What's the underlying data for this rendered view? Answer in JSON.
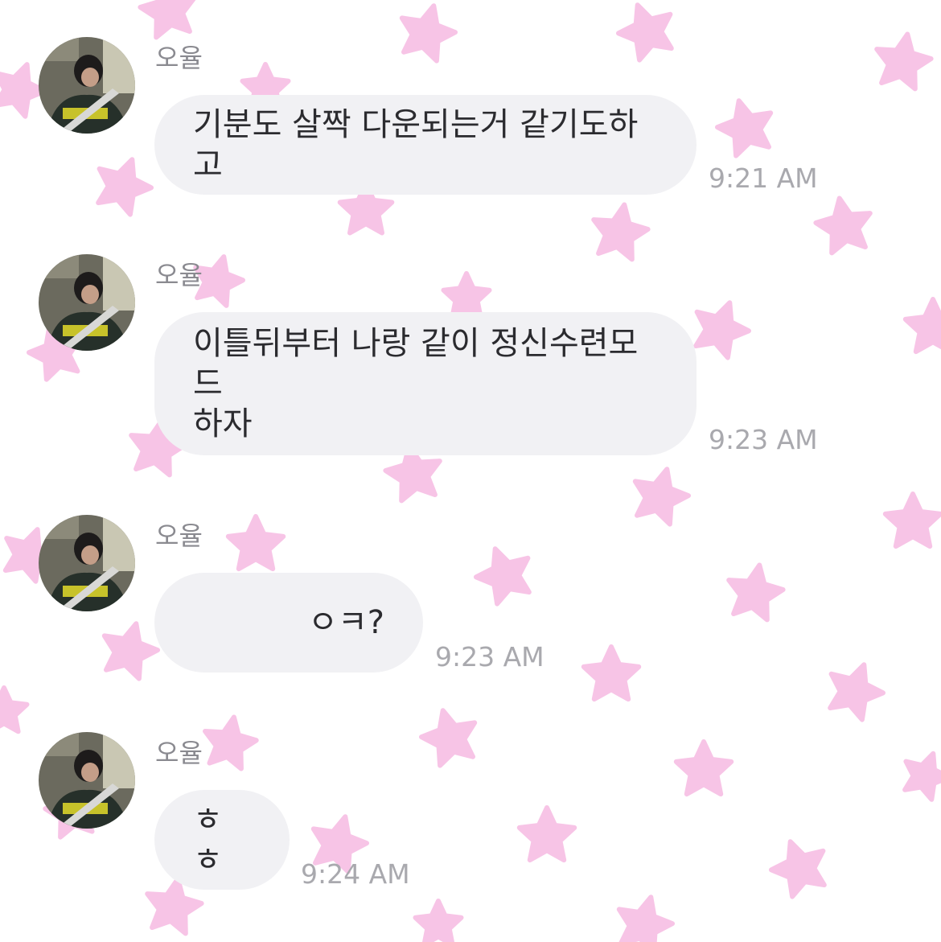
{
  "chat": {
    "messages": [
      {
        "sender": "오율",
        "text": "기분도 살짝 다운되는거 같기도하고",
        "time": "9:21 AM"
      },
      {
        "sender": "오율",
        "text": "이틀뒤부터 나랑 같이 정신수련모드\n하자",
        "time": "9:23 AM"
      },
      {
        "sender": "오율",
        "text": "ㅇㅋ?",
        "time": "9:23 AM"
      },
      {
        "sender": "오율",
        "text": "ㅎㅎ",
        "time": "9:24 AM"
      }
    ]
  },
  "theme": {
    "background": "#ffffff",
    "star_color": "#f7c4e6",
    "bubble_color": "#f1f1f4",
    "sender_color": "#8a8a90",
    "time_color": "#a9a9ae",
    "text_color": "#2b2b2f"
  },
  "icons": {
    "avatar": "profile-photo-icon",
    "background_pattern": "pink-star-icon"
  }
}
